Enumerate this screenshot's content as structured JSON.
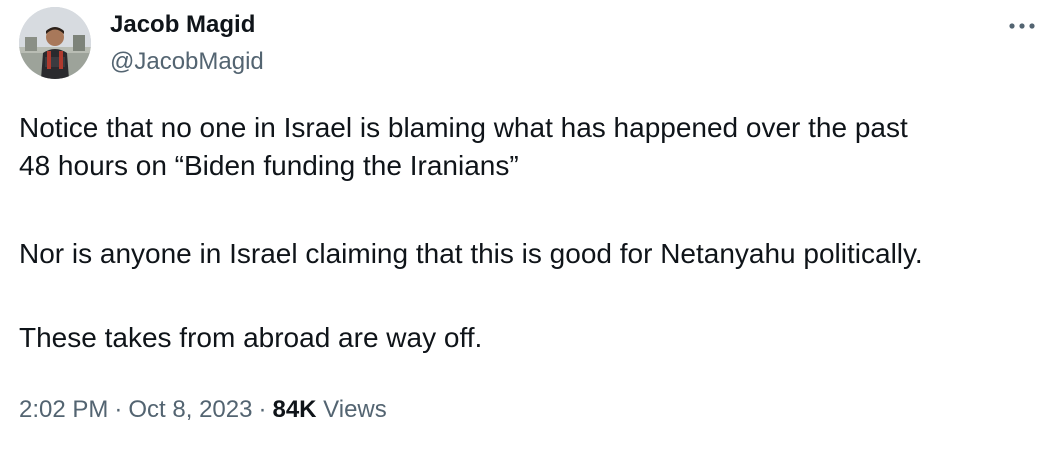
{
  "author": {
    "name": "Jacob Magid",
    "handle": "@JacobMagid"
  },
  "tweet": {
    "line1": "Notice that no one in Israel is blaming what has happened over the past",
    "line2": "48 hours on “Biden funding the Iranians”",
    "paragraph2": "Nor is anyone in Israel claiming that this is good for Netanyahu politically.",
    "paragraph3": "These takes from abroad are way off."
  },
  "meta": {
    "time": "2:02 PM",
    "separator": "·",
    "date": "Oct 8, 2023",
    "views_count": "84K",
    "views_label": "Views"
  },
  "icons": {
    "more": "more-horizontal-icon"
  },
  "colors": {
    "text": "#0f1419",
    "secondary": "#536471",
    "background": "#ffffff"
  }
}
